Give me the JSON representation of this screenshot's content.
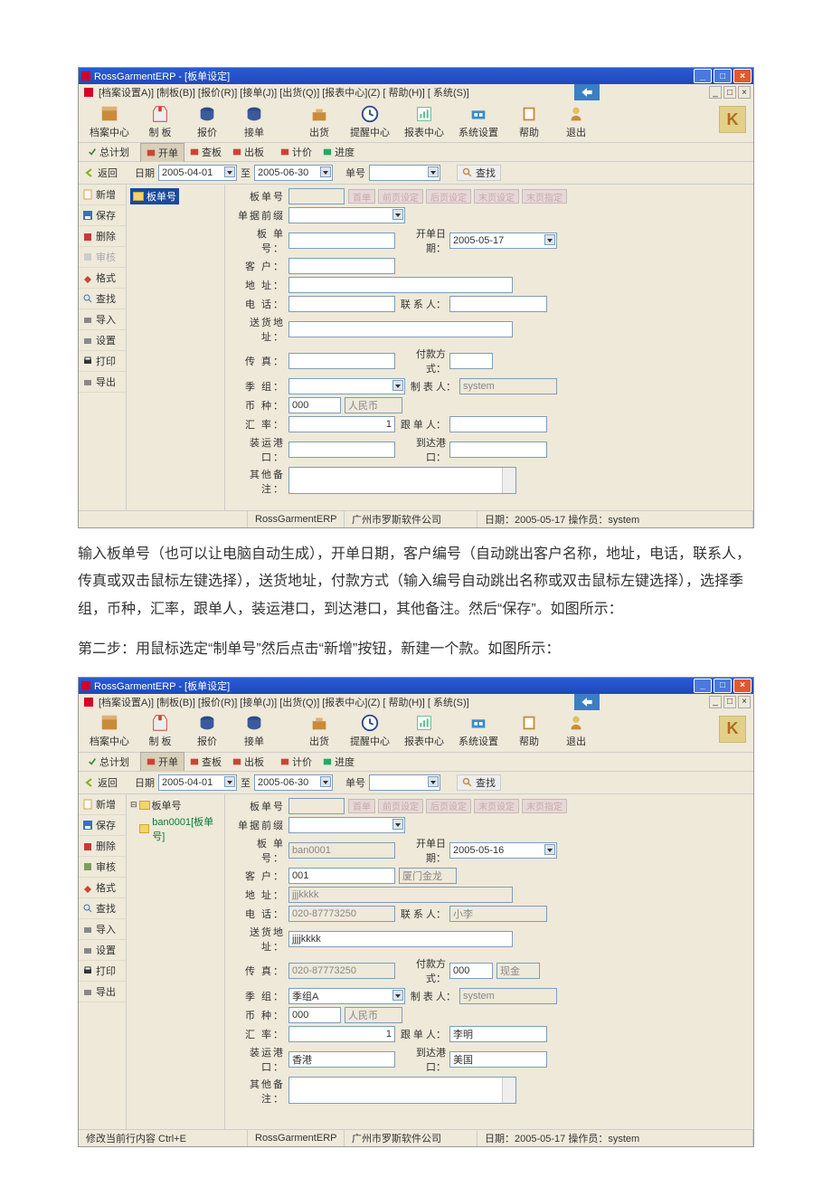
{
  "app": {
    "title": "RossGarmentERP - [板单设定]"
  },
  "menu": [
    "[档案设置A)]",
    "[制板(B)]",
    "[报价(R)]",
    "[接单(J)]",
    "[出货(Q)]",
    "[报表中心](Z)",
    "[ 帮助(H)]",
    "[ 系统(S)]"
  ],
  "toolbar": [
    {
      "l": "档案中心",
      "c": "#c98b3a"
    },
    {
      "l": "制 板",
      "c": "#c43"
    },
    {
      "l": "报价",
      "c": "#2a4a8c"
    },
    {
      "l": "接单",
      "c": "#2a4a8c"
    },
    {
      "l": "出货",
      "c": "#c98b3a"
    },
    {
      "l": "提醒中心",
      "c": "#2a4a8c"
    },
    {
      "l": "报表中心",
      "c": "#5b8"
    },
    {
      "l": "系统设置",
      "c": "#3a8cc4"
    },
    {
      "l": "帮助",
      "c": "#c98b3a"
    },
    {
      "l": "退出",
      "c": "#c98b3a"
    }
  ],
  "tabs1": {
    "left": "总计划",
    "items": [
      "开单",
      "查板",
      "出板",
      "计价",
      "进度"
    ]
  },
  "filter": {
    "back": "返回",
    "dateLab": "日期",
    "from": "2005-04-01",
    "to": "2005-06-30",
    "toLab": "至",
    "numLab": "单号",
    "search": "查找"
  },
  "sidebar": [
    "新增",
    "保存",
    "删除",
    "审核",
    "格式",
    "查找",
    "导入",
    "设置",
    "打印",
    "导出"
  ],
  "sidecolors": [
    "#d9a23a",
    "#3a70c4",
    "#c43a3a",
    "#7aa05a",
    "#333",
    "#3a70c4",
    "#888",
    "#888",
    "#333",
    "#888"
  ],
  "tree1": {
    "root": "板单号"
  },
  "form1": {
    "f": [
      [
        "板单号",
        ""
      ],
      [
        "单据前缀",
        ""
      ],
      [
        "板 单 号：",
        ""
      ],
      [
        "客    户：",
        ""
      ],
      [
        "地    址：",
        ""
      ],
      [
        "电    话：",
        ""
      ],
      [
        "送货地址：",
        ""
      ],
      [
        "传    真：",
        ""
      ],
      [
        "季    组：",
        ""
      ],
      [
        "币    种：",
        "000"
      ],
      [
        "汇    率：",
        ""
      ],
      [
        "装运港口：",
        ""
      ],
      [
        "其他备注：",
        ""
      ]
    ],
    "right": [
      [
        "开单日期：",
        "2005-05-17"
      ],
      [
        "联 系 人：",
        ""
      ],
      [
        "付款方式：",
        ""
      ],
      [
        "制 表 人：",
        "system"
      ],
      [
        "跟 单 人：",
        ""
      ],
      [
        "到达港口：",
        ""
      ]
    ],
    "rmbl": "人民币",
    "rate": "1"
  },
  "status1": {
    "left": "",
    "app": "RossGarmentERP",
    "co": "广州市罗斯软件公司",
    "date": "日期：2005-05-17 操作员：system"
  },
  "para1": "输入板单号（也可以让电脑自动生成），开单日期，客户编号（自动跳出客户名称，地址，电话，联系人，传真或双击鼠标左键选择），送货地址，付款方式（输入编号自动跳出名称或双击鼠标左键选择），选择季组，币种，汇率，跟单人，装运港口，到达港口，其他备注。然后“保存”。如图所示：",
  "para2": "第二步：用鼠标选定“制单号”然后点击“新增”按钮，新建一个款。如图所示：",
  "tree2": {
    "root": "板单号",
    "leaf": "ban0001[板单号]"
  },
  "form2": {
    "banhao": "ban0001",
    "kaidan": "2005-05-16",
    "kehu": "001",
    "kehum": "厦门金龙",
    "dizhi": "jjjkkkk",
    "dianhua": "020-87773250",
    "lianxi": "小李",
    "songhuo": "jjjjkkkk",
    "chuanzhen": "020-87773250",
    "fukuan": "000",
    "fukuanm": "现金",
    "jizu": "季组A",
    "zbr": "system",
    "bizhong": "000",
    "rmb": "人民币",
    "huilv": "1",
    "gendan": "李明",
    "zhuangyun": "香港",
    "daoda": "美国"
  },
  "status2": {
    "left": "修改当前行内容 Ctrl+E",
    "app": "RossGarmentERP",
    "co": "广州市罗斯软件公司",
    "date": "日期：2005-05-17 操作员：system"
  }
}
